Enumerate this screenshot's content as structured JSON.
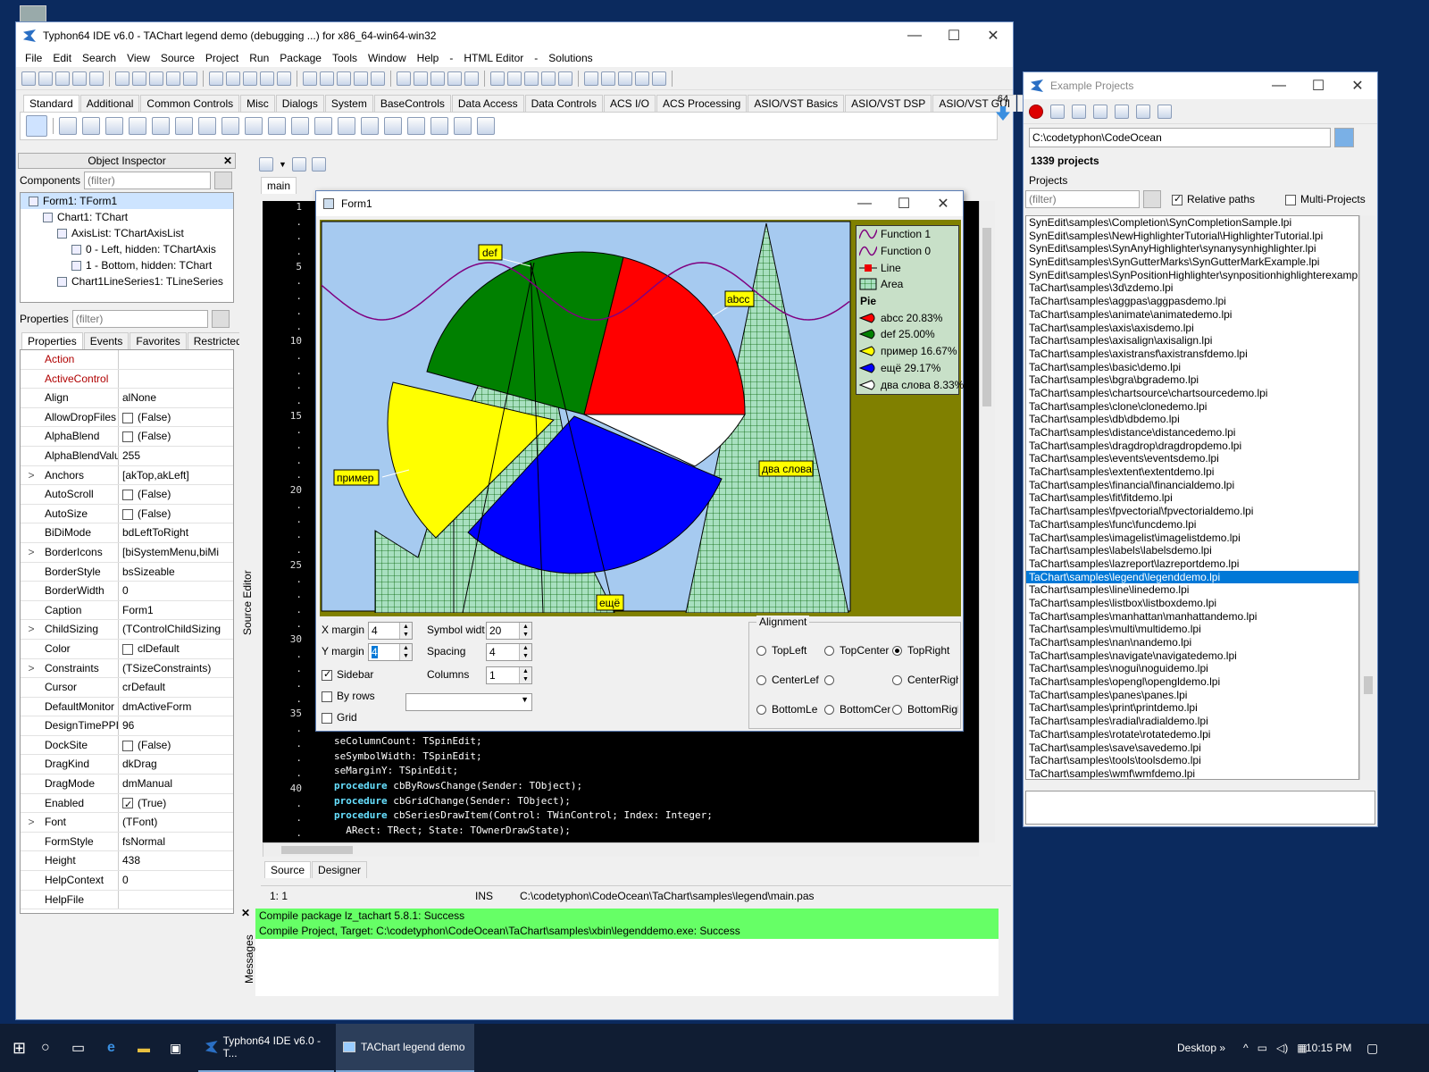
{
  "ide": {
    "title": "Typhon64 IDE v6.0 - TAChart legend demo (debugging ...) for x86_64-win64-win32",
    "menu": [
      "File",
      "Edit",
      "Search",
      "View",
      "Source",
      "Project",
      "Run",
      "Package",
      "Tools",
      "Window",
      "Help",
      "-",
      "HTML Editor",
      "-",
      "Solutions"
    ],
    "palette_tabs": [
      "Standard",
      "Additional",
      "Common Controls",
      "Misc",
      "Dialogs",
      "System",
      "BaseControls",
      "Data Access",
      "Data Controls",
      "ACS I/O",
      "ACS Processing",
      "ASIO/VST Basics",
      "ASIO/VST DSP",
      "ASIO/VST GUI",
      "AS"
    ],
    "palette_count": "64"
  },
  "object_inspector": {
    "title": "Object Inspector",
    "components_label": "Components",
    "filter_placeholder": "(filter)",
    "tree": [
      "Form1: TForm1",
      "Chart1: TChart",
      "AxisList: TChartAxisList",
      "0 - Left, hidden: TChartAxis",
      "1 - Bottom, hidden: TChart",
      "Chart1LineSeries1: TLineSeries"
    ],
    "properties_label": "Properties",
    "tabs": [
      "Properties",
      "Events",
      "Favorites",
      "Restricted"
    ],
    "props": [
      {
        "exp": "",
        "name": "Action",
        "value": "",
        "red": true
      },
      {
        "exp": "",
        "name": "ActiveControl",
        "value": "",
        "red": true
      },
      {
        "exp": "",
        "name": "Align",
        "value": "alNone"
      },
      {
        "exp": "",
        "name": "AllowDropFiles",
        "value": "(False)",
        "cb": "off"
      },
      {
        "exp": "",
        "name": "AlphaBlend",
        "value": "(False)",
        "cb": "off"
      },
      {
        "exp": "",
        "name": "AlphaBlendValu",
        "value": "255"
      },
      {
        "exp": ">",
        "name": "Anchors",
        "value": "[akTop,akLeft]"
      },
      {
        "exp": "",
        "name": "AutoScroll",
        "value": "(False)",
        "cb": "off"
      },
      {
        "exp": "",
        "name": "AutoSize",
        "value": "(False)",
        "cb": "off"
      },
      {
        "exp": "",
        "name": "BiDiMode",
        "value": "bdLeftToRight"
      },
      {
        "exp": ">",
        "name": "BorderIcons",
        "value": "[biSystemMenu,biMi"
      },
      {
        "exp": "",
        "name": "BorderStyle",
        "value": "bsSizeable"
      },
      {
        "exp": "",
        "name": "BorderWidth",
        "value": "0"
      },
      {
        "exp": "",
        "name": "Caption",
        "value": "Form1"
      },
      {
        "exp": ">",
        "name": "ChildSizing",
        "value": "(TControlChildSizing"
      },
      {
        "exp": "",
        "name": "Color",
        "value": "clDefault",
        "swatch": true
      },
      {
        "exp": ">",
        "name": "Constraints",
        "value": "(TSizeConstraints)"
      },
      {
        "exp": "",
        "name": "Cursor",
        "value": "crDefault"
      },
      {
        "exp": "",
        "name": "DefaultMonitor",
        "value": "dmActiveForm"
      },
      {
        "exp": "",
        "name": "DesignTimePPI",
        "value": "96"
      },
      {
        "exp": "",
        "name": "DockSite",
        "value": "(False)",
        "cb": "off"
      },
      {
        "exp": "",
        "name": "DragKind",
        "value": "dkDrag"
      },
      {
        "exp": "",
        "name": "DragMode",
        "value": "dmManual"
      },
      {
        "exp": "",
        "name": "Enabled",
        "value": "(True)",
        "cb": "on"
      },
      {
        "exp": ">",
        "name": "Font",
        "value": "(TFont)"
      },
      {
        "exp": "",
        "name": "FormStyle",
        "value": "fsNormal"
      },
      {
        "exp": "",
        "name": "Height",
        "value": "438"
      },
      {
        "exp": "",
        "name": "HelpContext",
        "value": "0"
      },
      {
        "exp": "",
        "name": "HelpFile",
        "value": ""
      }
    ]
  },
  "editor": {
    "tab": "main",
    "side_label": "Source Editor",
    "line_numbers": [
      "1",
      ".",
      ".",
      ".",
      "5",
      ".",
      ".",
      ".",
      ".",
      "10",
      ".",
      ".",
      ".",
      ".",
      "15",
      ".",
      ".",
      ".",
      ".",
      "20",
      ".",
      ".",
      ".",
      ".",
      "25",
      ".",
      ".",
      ".",
      ".",
      "30",
      ".",
      ".",
      ".",
      ".",
      "35",
      ".",
      ".",
      ".",
      ".",
      "40",
      ".",
      ".",
      "."
    ],
    "code_lines": [
      {
        "kw": "",
        "rest": "seColumnCount: TSpinEdit;"
      },
      {
        "kw": "",
        "rest": "seSymbolWidth: TSpinEdit;"
      },
      {
        "kw": "",
        "rest": "seMarginY: TSpinEdit;"
      },
      {
        "kw": "procedure",
        "rest": " cbByRowsChange(Sender: TObject);"
      },
      {
        "kw": "procedure",
        "rest": " cbGridChange(Sender: TObject);"
      },
      {
        "kw": "procedure",
        "rest": " cbSeriesDrawItem(Control: TWinControl; Index: Integer;"
      },
      {
        "kw": "",
        "rest": "  ARect: TRect; State: TOwnerDrawState);"
      }
    ],
    "bottom_tabs": [
      "Source",
      "Designer"
    ],
    "status": {
      "pos": "1:  1",
      "mode": "INS",
      "file": "C:\\codetyphon\\CodeOcean\\TaChart\\samples\\legend\\main.pas"
    }
  },
  "messages": {
    "label": "Messages",
    "lines": [
      "Compile package lz_tachart 5.8.1: Success",
      "Compile Project, Target: C:\\codetyphon\\CodeOcean\\TaChart\\samples\\xbin\\legenddemo.exe: Success"
    ]
  },
  "form1": {
    "title": "Form1",
    "marks": {
      "def": "def",
      "abcc": "abcc",
      "primer": "пример",
      "dva": "два слова",
      "esche": "ещё"
    },
    "legend": {
      "items": [
        {
          "label": "Function 1",
          "sym": "wave"
        },
        {
          "label": "Function 0",
          "sym": "wave"
        },
        {
          "label": "Line",
          "sym": "line"
        },
        {
          "label": "Area",
          "sym": "area"
        }
      ],
      "pie_title": "Pie",
      "pie_items": [
        {
          "label": "abcc 20.83%",
          "color": "#ff0000"
        },
        {
          "label": "def 25.00%",
          "color": "#008000"
        },
        {
          "label": "пример 16.67%",
          "color": "#ffff00"
        },
        {
          "label": "ещё 29.17%",
          "color": "#0000ff"
        },
        {
          "label": "два слова 8.33%",
          "color": "#ffffff"
        }
      ]
    },
    "controls": {
      "x_margin_label": "X margin",
      "x_margin": "4",
      "y_margin_label": "Y margin",
      "y_margin": "4",
      "symbol_width_label": "Symbol widt",
      "symbol_width": "20",
      "spacing_label": "Spacing",
      "spacing": "4",
      "columns_label": "Columns",
      "columns": "1",
      "sidebar": "Sidebar",
      "by_rows": "By rows",
      "grid": "Grid",
      "alignment_title": "Alignment",
      "alignment": [
        "TopLeft",
        "TopCenter",
        "TopRight",
        "CenterLef",
        "",
        "CenterRigh",
        "BottomLe",
        "BottomCent",
        "BottomRigl"
      ]
    }
  },
  "example_projects": {
    "title": "Example Projects",
    "path": "C:\\codetyphon\\CodeOcean",
    "count": "1339 projects",
    "projects_label": "Projects",
    "filter_placeholder": "(filter)",
    "relative_paths": "Relative paths",
    "multi_projects": "Multi-Projects",
    "items": [
      "SynEdit\\samples\\Completion\\SynCompletionSample.lpi",
      "SynEdit\\samples\\NewHighlighterTutorial\\HighlighterTutorial.lpi",
      "SynEdit\\samples\\SynAnyHighlighter\\synanysynhighlighter.lpi",
      "SynEdit\\samples\\SynGutterMarks\\SynGutterMarkExample.lpi",
      "SynEdit\\samples\\SynPositionHighlighter\\synpositionhighlighterexample",
      "TaChart\\samples\\3d\\zdemo.lpi",
      "TaChart\\samples\\aggpas\\aggpasdemo.lpi",
      "TaChart\\samples\\animate\\animatedemo.lpi",
      "TaChart\\samples\\axis\\axisdemo.lpi",
      "TaChart\\samples\\axisalign\\axisalign.lpi",
      "TaChart\\samples\\axistransf\\axistransfdemo.lpi",
      "TaChart\\samples\\basic\\demo.lpi",
      "TaChart\\samples\\bgra\\bgrademo.lpi",
      "TaChart\\samples\\chartsource\\chartsourcedemo.lpi",
      "TaChart\\samples\\clone\\clonedemo.lpi",
      "TaChart\\samples\\db\\dbdemo.lpi",
      "TaChart\\samples\\distance\\distancedemo.lpi",
      "TaChart\\samples\\dragdrop\\dragdropdemo.lpi",
      "TaChart\\samples\\events\\eventsdemo.lpi",
      "TaChart\\samples\\extent\\extentdemo.lpi",
      "TaChart\\samples\\financial\\financialdemo.lpi",
      "TaChart\\samples\\fit\\fitdemo.lpi",
      "TaChart\\samples\\fpvectorial\\fpvectorialdemo.lpi",
      "TaChart\\samples\\func\\funcdemo.lpi",
      "TaChart\\samples\\imagelist\\imagelistdemo.lpi",
      "TaChart\\samples\\labels\\labelsdemo.lpi",
      "TaChart\\samples\\lazreport\\lazreportdemo.lpi",
      "TaChart\\samples\\legend\\legenddemo.lpi",
      "TaChart\\samples\\line\\linedemo.lpi",
      "TaChart\\samples\\listbox\\listboxdemo.lpi",
      "TaChart\\samples\\manhattan\\manhattandemo.lpi",
      "TaChart\\samples\\multi\\multidemo.lpi",
      "TaChart\\samples\\nan\\nandemo.lpi",
      "TaChart\\samples\\navigate\\navigatedemo.lpi",
      "TaChart\\samples\\nogui\\noguidemo.lpi",
      "TaChart\\samples\\opengl\\opengldemo.lpi",
      "TaChart\\samples\\panes\\panes.lpi",
      "TaChart\\samples\\print\\printdemo.lpi",
      "TaChart\\samples\\radial\\radialdemo.lpi",
      "TaChart\\samples\\rotate\\rotatedemo.lpi",
      "TaChart\\samples\\save\\savedemo.lpi",
      "TaChart\\samples\\tools\\toolsdemo.lpi",
      "TaChart\\samples\\wmf\\wmfdemo.lpi"
    ],
    "selected_index": 27
  },
  "taskbar": {
    "app1": "Typhon64 IDE v6.0 - T...",
    "app2": "TAChart legend demo",
    "desktop": "Desktop",
    "time": "10:15 PM"
  }
}
